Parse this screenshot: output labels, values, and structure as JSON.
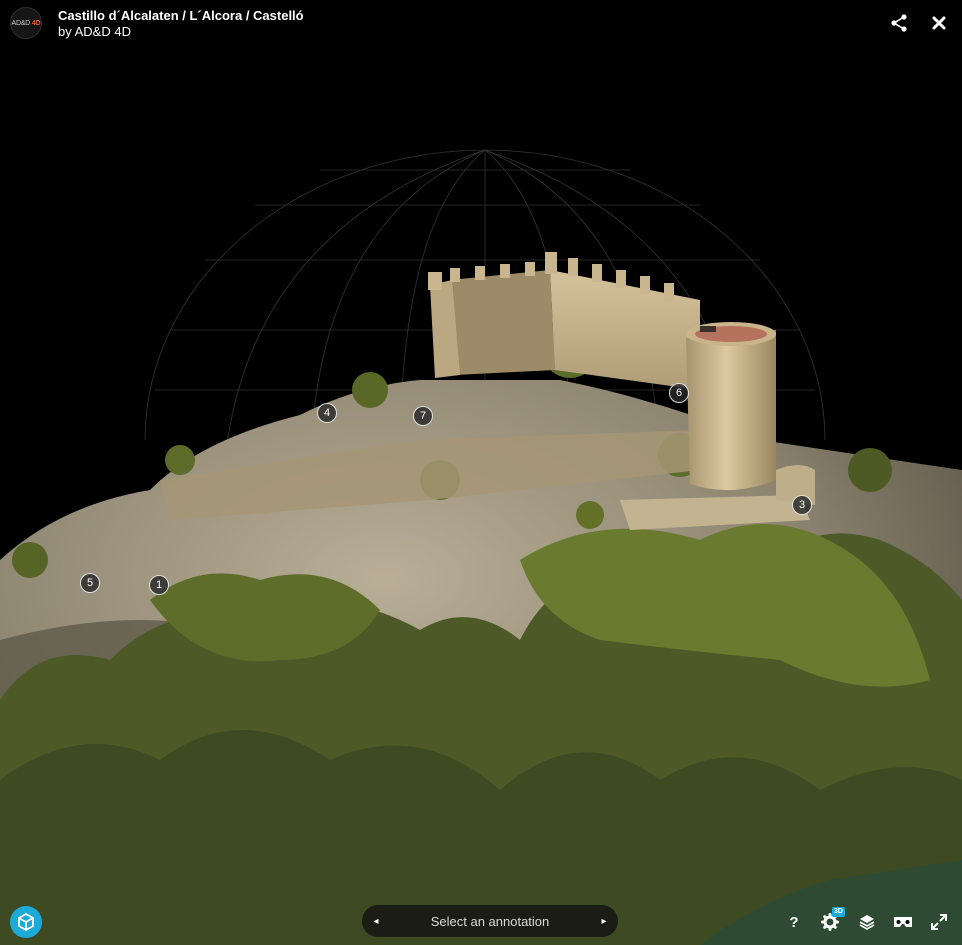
{
  "header": {
    "avatar_text_a": "AD&D",
    "avatar_text_b": "4D",
    "title": "Castillo d´Alcalaten / L´Alcora / Castelló",
    "by_prefix": "by ",
    "author": "AD&D 4D"
  },
  "toolbar": {
    "share_icon": "share-icon",
    "close_icon": "close-icon"
  },
  "annotations": {
    "markers": [
      "1",
      "3",
      "4",
      "5",
      "6",
      "7"
    ]
  },
  "bottom_bar": {
    "annotation_nav_label": "Select an annotation",
    "prev_icon": "◂",
    "next_icon": "▸",
    "help_label": "?",
    "settings_badge": "3D",
    "icons": [
      "logo-icon",
      "help-icon",
      "settings-icon",
      "layers-icon",
      "vr-icon",
      "fullscreen-icon"
    ]
  },
  "colors": {
    "brand": "#1caad9",
    "logo_accent": "#e05a28",
    "background": "#000000"
  }
}
